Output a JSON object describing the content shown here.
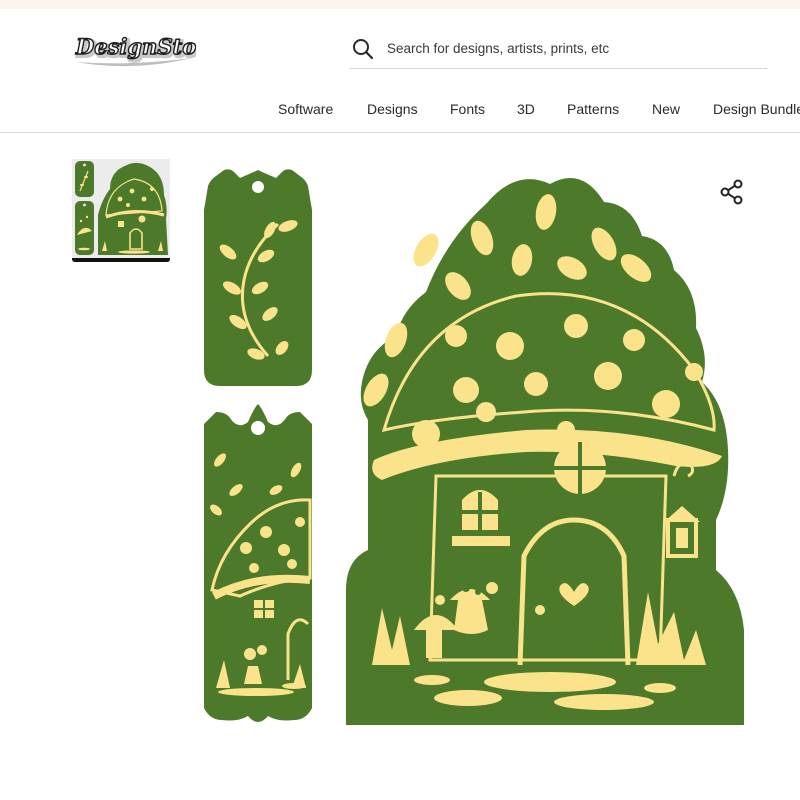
{
  "header": {
    "logo_text": "DesignStore",
    "search_placeholder": "Search for designs, artists, prints, etc"
  },
  "nav": {
    "items": [
      {
        "label": "Software"
      },
      {
        "label": "Designs"
      },
      {
        "label": "Fonts"
      },
      {
        "label": "3D"
      },
      {
        "label": "Patterns"
      },
      {
        "label": "New"
      },
      {
        "label": "Design Bundles"
      }
    ]
  },
  "product": {
    "thumbnail": "mushroom-house-svg-thumbnail",
    "share_icon": "share-icon",
    "colors": {
      "green": "#4d7a2a",
      "yellow": "#fbe38c"
    }
  }
}
